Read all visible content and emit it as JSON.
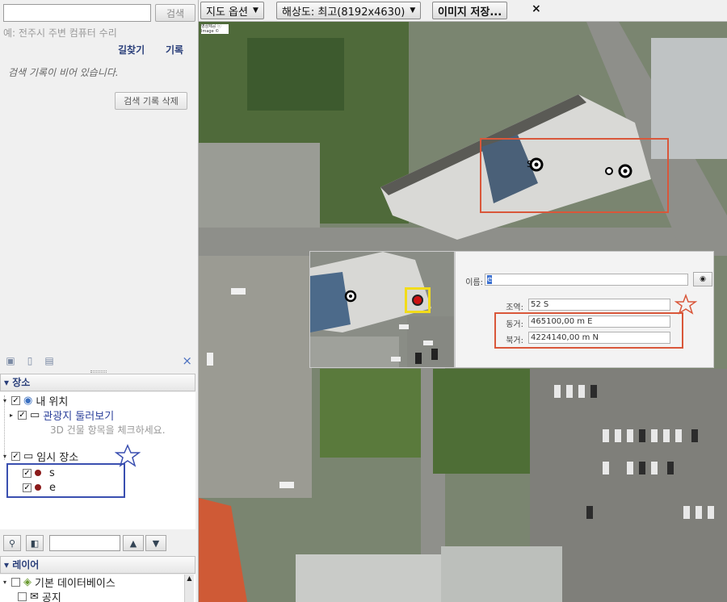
{
  "search": {
    "button": "검색",
    "example": "예: 전주시 주변 컴퓨터 수리",
    "value": ""
  },
  "tabs": {
    "directions": "길찾기",
    "history": "기록"
  },
  "history": {
    "empty": "검색 기록이 비어 있습니다.",
    "clear": "검색 기록 삭제"
  },
  "places": {
    "header": "장소",
    "my_location": "내 위치",
    "tour": "관광지 둘러보기",
    "tour_hint": "3D 건물 항목을 체크하세요.",
    "temp": "임시 장소",
    "items": [
      "s",
      "e"
    ]
  },
  "layers": {
    "header": "레이어",
    "primary": "기본 데이터베이스",
    "notice": "공지"
  },
  "toolbar": {
    "map_options": "지도 옵션",
    "resolution": "해상도: 최고(8192x4630)",
    "save_image": "이미지 저장...",
    "close": "×"
  },
  "dialog": {
    "name_label": "이름:",
    "name_value": "e",
    "zone_label": "조역:",
    "zone_value": "52 S",
    "easting_label": "동거:",
    "easting_value": "465100,00 m E",
    "northing_label": "북거:",
    "northing_value": "4224140,00 m N"
  },
  "map": {
    "copyright": "영상제공 ⓒ Image © Maxar"
  },
  "colors": {
    "accent": "#2a3f7a",
    "highlight": "#d9573a",
    "marker": "#cc1111",
    "selection": "#3a4fb0"
  }
}
